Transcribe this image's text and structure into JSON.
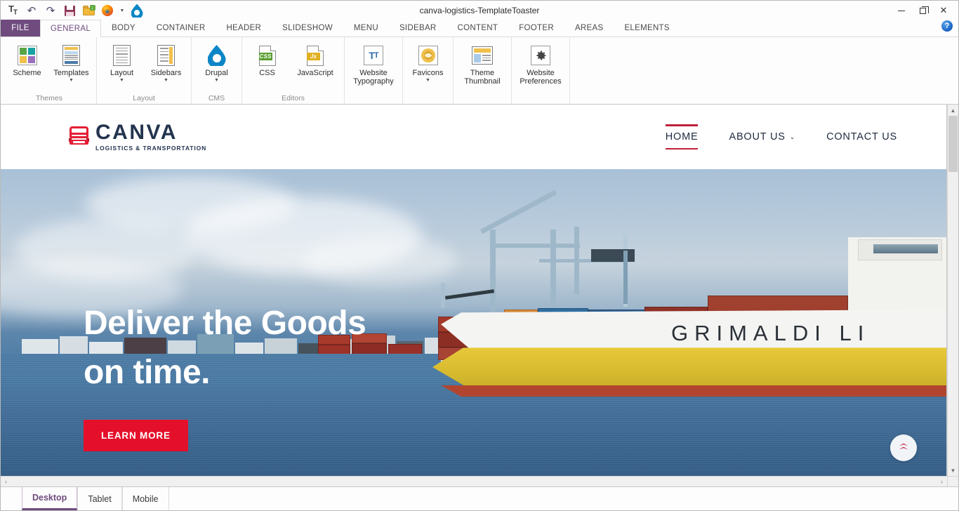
{
  "window": {
    "title": "canva-logistics-TemplateToaster",
    "minimize_label": "Minimize",
    "restore_label": "Restore",
    "close_label": "Close",
    "help_label": "?"
  },
  "quick_access": [
    {
      "name": "typography-icon",
      "label": "T"
    },
    {
      "name": "undo-icon",
      "label": "↶"
    },
    {
      "name": "redo-icon",
      "label": "↷"
    },
    {
      "name": "save-icon",
      "label": "Save"
    },
    {
      "name": "open-icon",
      "label": "Open"
    },
    {
      "name": "firefox-preview-icon",
      "label": "Preview in Firefox"
    },
    {
      "name": "drupal-icon",
      "label": "Drupal"
    }
  ],
  "ribbon": {
    "file_tab": "FILE",
    "tabs": [
      {
        "label": "GENERAL",
        "active": true
      },
      {
        "label": "BODY",
        "active": false
      },
      {
        "label": "CONTAINER",
        "active": false
      },
      {
        "label": "HEADER",
        "active": false
      },
      {
        "label": "SLIDESHOW",
        "active": false
      },
      {
        "label": "MENU",
        "active": false
      },
      {
        "label": "SIDEBAR",
        "active": false
      },
      {
        "label": "CONTENT",
        "active": false
      },
      {
        "label": "FOOTER",
        "active": false
      },
      {
        "label": "AREAS",
        "active": false
      },
      {
        "label": "ELEMENTS",
        "active": false
      }
    ],
    "groups": [
      {
        "label": "Themes",
        "items": [
          {
            "label": "Scheme",
            "icon": "color-scheme-icon",
            "caret": false
          },
          {
            "label": "Templates",
            "icon": "templates-icon",
            "caret": true
          }
        ]
      },
      {
        "label": "Layout",
        "items": [
          {
            "label": "Layout",
            "icon": "layout-icon",
            "caret": true
          },
          {
            "label": "Sidebars",
            "icon": "sidebars-icon",
            "caret": true
          }
        ]
      },
      {
        "label": "CMS",
        "items": [
          {
            "label": "Drupal",
            "icon": "drupal-icon",
            "caret": true
          }
        ]
      },
      {
        "label": "Editors",
        "items": [
          {
            "label": "CSS",
            "icon": "css-file-icon",
            "chip": "CSS",
            "chip_color": "#5a9e2f",
            "caret": false
          },
          {
            "label": "JavaScript",
            "icon": "js-file-icon",
            "chip": "Js",
            "chip_color": "#e0b020",
            "caret": false
          }
        ]
      },
      {
        "label": "",
        "items": [
          {
            "label": "Website Typography",
            "icon": "typography-icon",
            "caret": false
          }
        ]
      },
      {
        "label": "",
        "items": [
          {
            "label": "Favicons",
            "icon": "favicon-icon",
            "caret": true
          }
        ]
      },
      {
        "label": "",
        "items": [
          {
            "label": "Theme Thumbnail",
            "icon": "theme-thumbnail-icon",
            "caret": false
          }
        ]
      },
      {
        "label": "",
        "items": [
          {
            "label": "Website Preferences",
            "icon": "gear-icon",
            "caret": false
          }
        ]
      }
    ]
  },
  "site": {
    "logo": {
      "name": "CANVA",
      "tagline": "LOGISTICS & TRANSPORTATION",
      "icon": "truck-icon"
    },
    "nav": [
      {
        "label": "HOME",
        "active": true,
        "caret": false
      },
      {
        "label": "ABOUT US",
        "active": false,
        "caret": true
      },
      {
        "label": "CONTACT US",
        "active": false,
        "caret": false
      }
    ],
    "hero": {
      "line1": "Deliver  the Goods",
      "line2": "on time.",
      "button": "LEARN MORE",
      "ship_name": "GRIMALDI LI",
      "scroll_top_icon": "double-chevron-up-icon"
    }
  },
  "device_tabs": [
    {
      "label": "Desktop",
      "active": true
    },
    {
      "label": "Tablet",
      "active": false
    },
    {
      "label": "Mobile",
      "active": false
    }
  ],
  "colors": {
    "accent_purple": "#6f4b7e",
    "brand_red": "#e4102b",
    "nav_underline_red": "#c0213a",
    "logo_navy": "#23344f"
  }
}
